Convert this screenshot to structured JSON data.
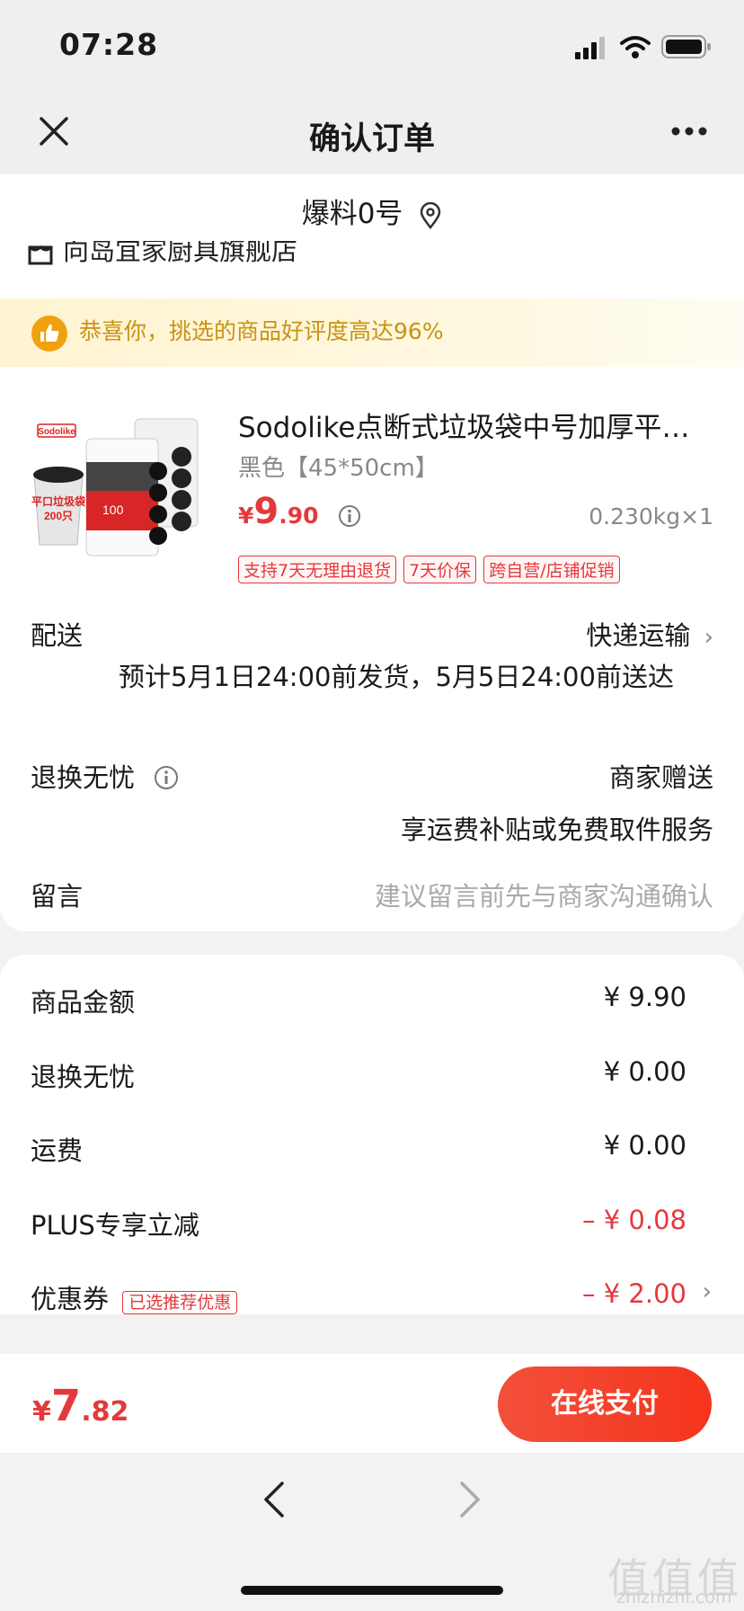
{
  "status": {
    "time": "07:28"
  },
  "nav": {
    "title": "确认订单"
  },
  "address": {
    "name": "爆料0号"
  },
  "shop": {
    "name": "向岛宜家厨具旗舰店"
  },
  "banner": {
    "text": "恭喜你，挑选的商品好评度高达96%"
  },
  "product": {
    "brand_logo": "Sodolike",
    "package_text": "平口垃圾袋\n200只",
    "title": "Sodolike点断式垃圾袋中号加厚平口…",
    "spec": "黑色【45*50cm】",
    "price_symbol": "¥",
    "price_int": "9",
    "price_dec": ".90",
    "weight": "0.230kg×1",
    "tags": [
      "支持7天无理由退货",
      "7天价保",
      "跨自营/店铺促销"
    ]
  },
  "delivery": {
    "label": "配送",
    "method": "快递运输",
    "estimate": "预计5月1日24:00前发货，5月5日24:00前送达"
  },
  "returns": {
    "label": "退换无忧",
    "value": "商家赠送",
    "detail": "享运费补贴或免费取件服务"
  },
  "message": {
    "label": "留言",
    "placeholder": "建议留言前先与商家沟通确认"
  },
  "fees": [
    {
      "label": "商品金额",
      "value": "¥ 9.90"
    },
    {
      "label": "退换无忧",
      "value": "¥ 0.00"
    },
    {
      "label": "运费",
      "value": "¥ 0.00"
    },
    {
      "label": "PLUS专享立减",
      "value": "– ¥ 0.08"
    },
    {
      "label": "优惠券",
      "badge": "已选推荐优惠",
      "value": "– ¥ 2.00"
    }
  ],
  "footer": {
    "total_symbol": "¥",
    "total_int": "7",
    "total_dec": ".82",
    "pay_label": "在线支付"
  },
  "watermark": {
    "glyphs": "值值值",
    "site": "zhizhizhi.com"
  },
  "colors": {
    "accent": "#e4393c",
    "banner_text": "#c99312",
    "pay_button": "#f6341d"
  }
}
